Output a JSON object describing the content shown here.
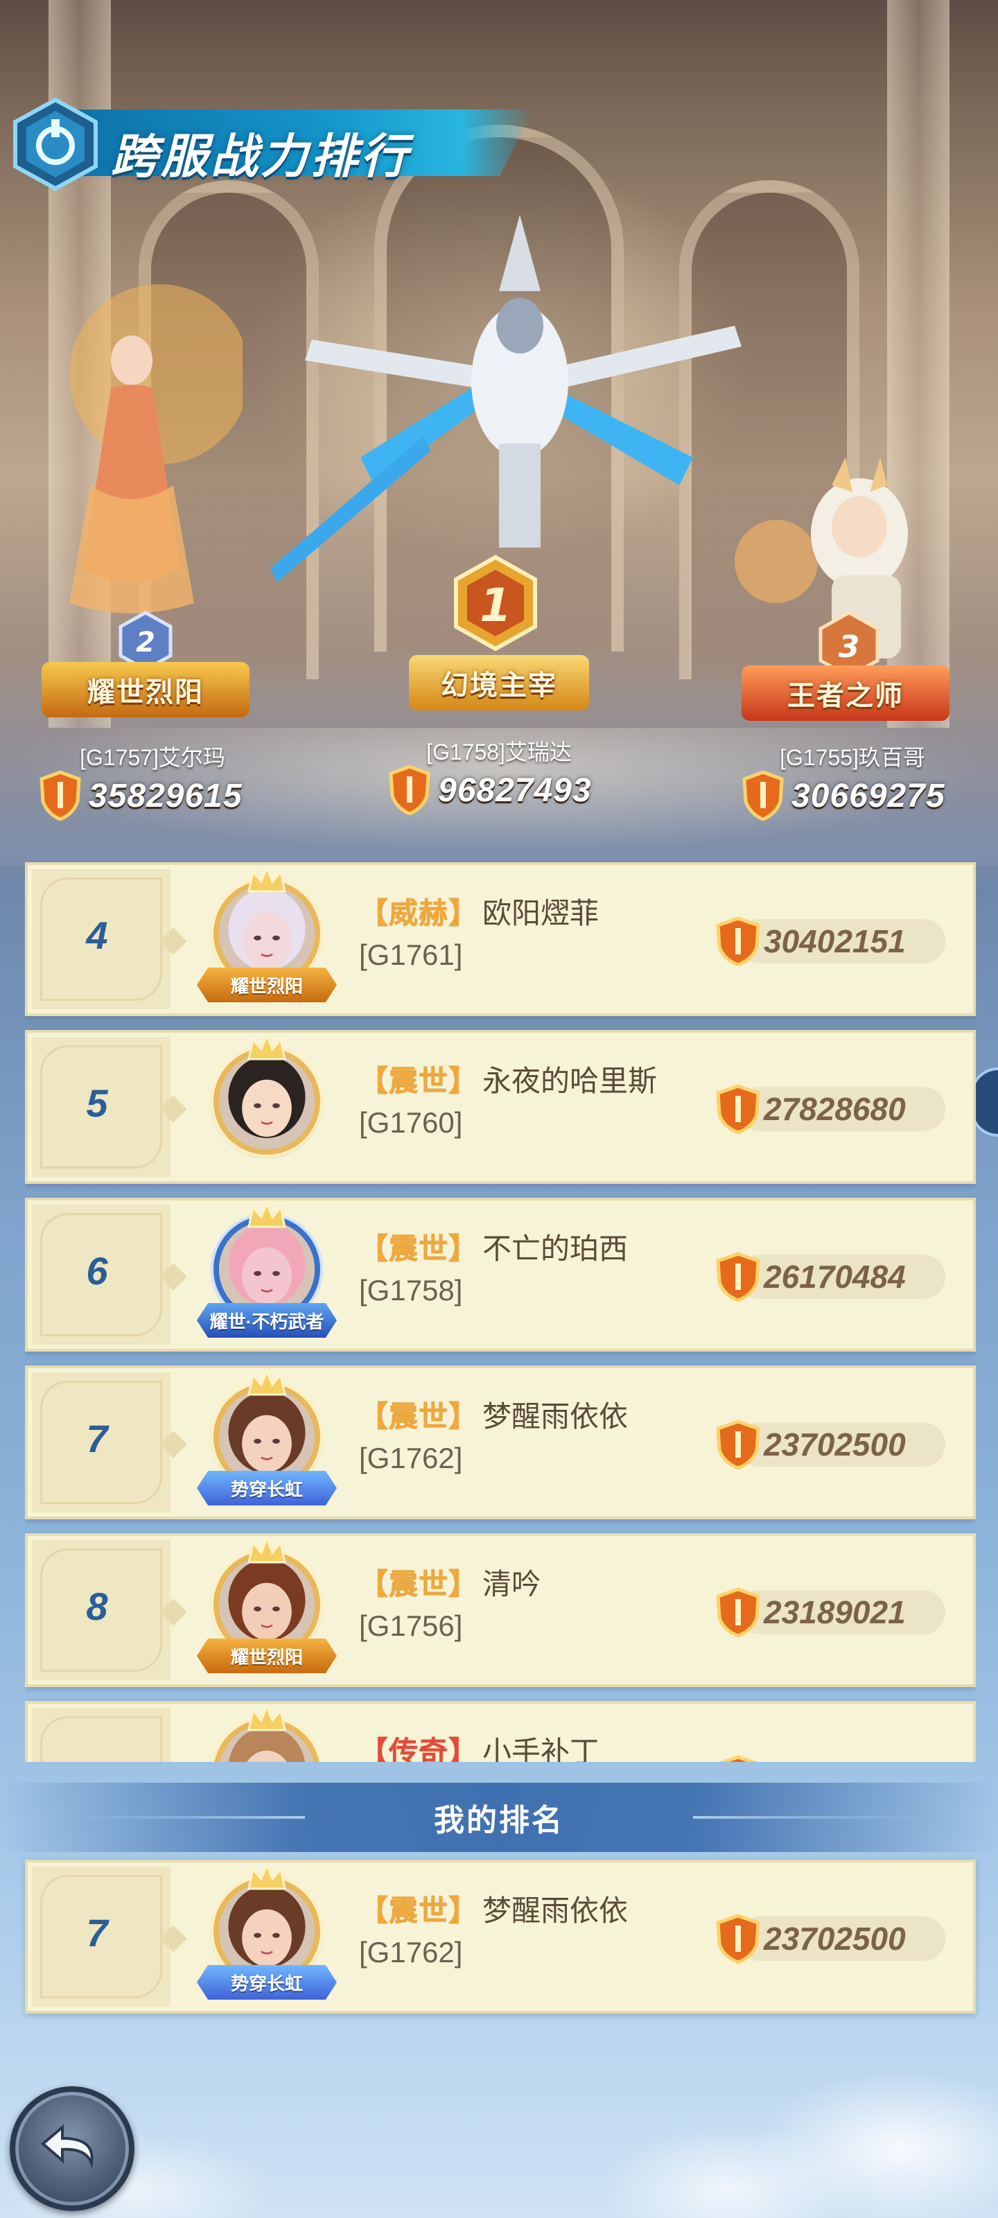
{
  "title": "跨服战力排行",
  "top_three": [
    {
      "rank": "2",
      "title_badge": "耀世烈阳",
      "name": "[G1757]艾尔玛",
      "power": "35829615"
    },
    {
      "rank": "1",
      "title_badge": "幻境主宰",
      "name": "[G1758]艾瑞达",
      "power": "96827493"
    },
    {
      "rank": "3",
      "title_badge": "王者之师",
      "name": "[G1755]玖百哥",
      "power": "30669275"
    }
  ],
  "rows": [
    {
      "rank": "4",
      "honor": "【威赫】",
      "name": "欧阳熤菲",
      "server": "[G1761]",
      "power": "30402151",
      "frame_tag": "耀世烈阳"
    },
    {
      "rank": "5",
      "honor": "【震世】",
      "name": "永夜的哈里斯",
      "server": "[G1760]",
      "power": "27828680",
      "frame_tag": ""
    },
    {
      "rank": "6",
      "honor": "【震世】",
      "name": "不亡的珀西",
      "server": "[G1758]",
      "power": "26170484",
      "frame_tag": "耀世·不朽武者"
    },
    {
      "rank": "7",
      "honor": "【震世】",
      "name": "梦醒雨依依",
      "server": "[G1762]",
      "power": "23702500",
      "frame_tag": "势穿长虹"
    },
    {
      "rank": "8",
      "honor": "【震世】",
      "name": "清吟",
      "server": "[G1756]",
      "power": "23189021",
      "frame_tag": "耀世烈阳"
    },
    {
      "rank": "",
      "honor": "【传奇】",
      "name": "小手补丁",
      "server": "",
      "power": "",
      "frame_tag": ""
    }
  ],
  "my_rank": {
    "header": "我的排名",
    "rank": "7",
    "honor": "【震世】",
    "name": "梦醒雨依依",
    "server": "[G1762]",
    "power": "23702500",
    "frame_tag": "势穿长虹"
  },
  "colors": {
    "accent_blue": "#2a5e98",
    "honor_gold": "#f0a83a",
    "honor_red": "#e44a3a",
    "row_bg": "#f7f3d6"
  },
  "icons": {
    "power": "shield-flame-icon",
    "back": "back-arrow-icon",
    "emblem": "shield-emblem-icon"
  }
}
